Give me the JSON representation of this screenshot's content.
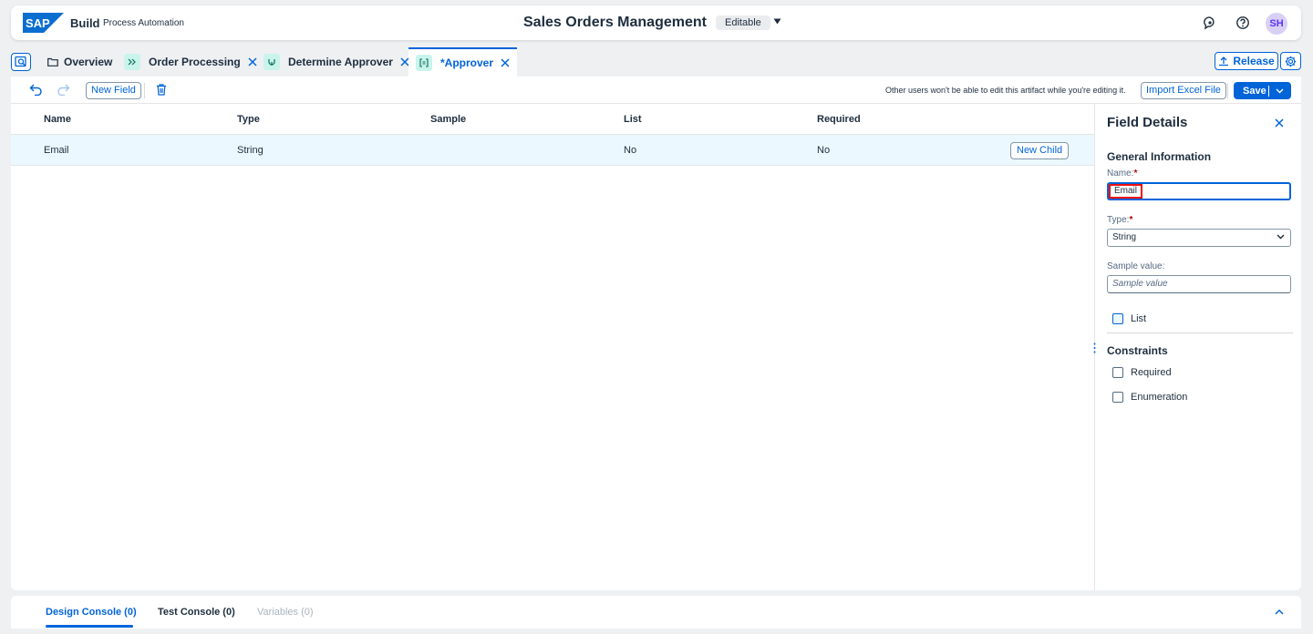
{
  "shell": {
    "brand": "Build",
    "brand_sub": "Process Automation",
    "title": "Sales Orders Management",
    "status": "Editable",
    "avatar": "SH",
    "colors": {
      "accent": "#0064d9",
      "avatar_bg": "#d8d0f5"
    }
  },
  "tabs": [
    {
      "label": "Overview",
      "icon": "folder-icon",
      "closable": false
    },
    {
      "label": "Order Processing",
      "icon": "process-icon",
      "closable": true
    },
    {
      "label": "Determine Approver",
      "icon": "decision-icon",
      "closable": true
    },
    {
      "label": "*Approver",
      "icon": "data-type-icon",
      "closable": true,
      "active": true
    }
  ],
  "actions": {
    "release": "Release"
  },
  "toolbar": {
    "new_field": "New Field",
    "lock_message": "Other users won't be able to edit this artifact while you're editing it.",
    "import": "Import Excel File",
    "save": "Save"
  },
  "table": {
    "headers": [
      "Name",
      "Type",
      "Sample",
      "List",
      "Required"
    ],
    "rows": [
      {
        "name": "Email",
        "type": "String",
        "sample": "",
        "list": "No",
        "required": "No",
        "action": "New Child"
      }
    ]
  },
  "details": {
    "title": "Field Details",
    "general": "General Information",
    "name_label": "Name:",
    "name_value": "Email",
    "type_label": "Type:",
    "type_value": "String",
    "sample_label": "Sample value:",
    "sample_placeholder": "Sample value",
    "list_label": "List",
    "constraints": "Constraints",
    "required_label": "Required",
    "enumeration_label": "Enumeration",
    "req_marker": "*"
  },
  "console": {
    "design": "Design Console (0)",
    "test": "Test Console (0)",
    "variables": "Variables (0)"
  }
}
